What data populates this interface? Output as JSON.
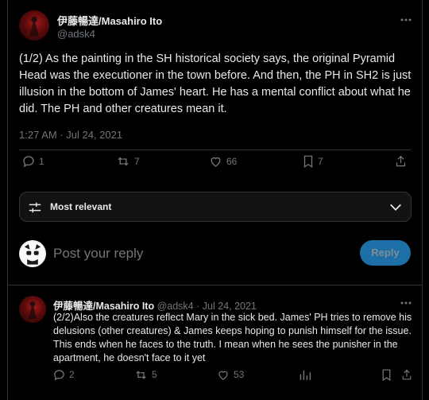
{
  "main_tweet": {
    "display_name": "伊藤暢達/Masahiro Ito",
    "handle": "@adsk4",
    "text": "(1/2) As the painting in the SH historical society says, the original Pyramid Head was the executioner in the town before. And then, the PH in SH2 is just illusion in the bottom of James' heart. He has a mental conflict about what he did. The PH and other creatures mean it.",
    "timestamp": "1:27 AM · Jul 24, 2021",
    "replies": "1",
    "reposts": "7",
    "likes": "66",
    "bookmarks": "7"
  },
  "sort": {
    "label": "Most relevant"
  },
  "composer": {
    "placeholder": "Post your reply",
    "button": "Reply"
  },
  "reply_tweet": {
    "display_name": "伊藤暢達/Masahiro Ito",
    "handle": "@adsk4",
    "date": "Jul 24, 2021",
    "separator": "·",
    "text": "(2/2)Also the creatures reflect Mary in the sick bed. James' PH tries to remove his delusions (other creatures) & James keeps hoping to punish himself for the issue. This ends when he faces to the truth. I mean when he sees the punisher in the apartment, he doesn't face to it yet",
    "replies": "2",
    "reposts": "5",
    "likes": "53"
  },
  "colors": {
    "accent": "#1d9bf0",
    "background": "#000000",
    "border": "#2f3336",
    "muted": "#71767b"
  }
}
